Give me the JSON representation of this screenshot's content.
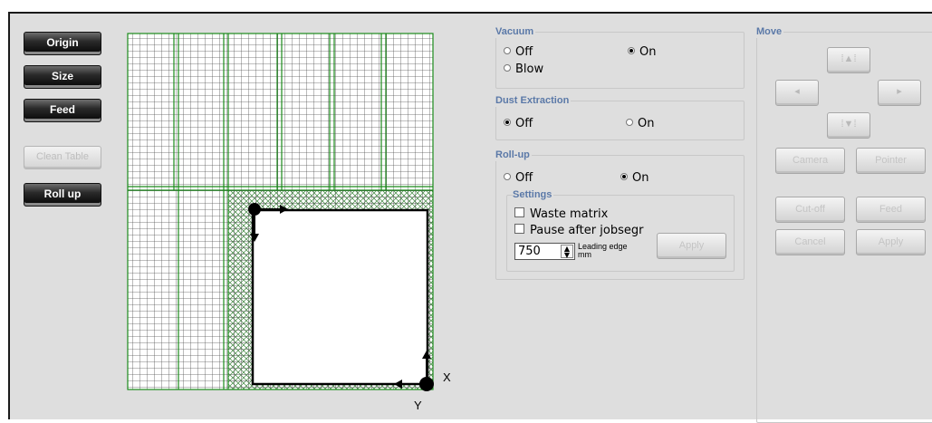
{
  "left_buttons": {
    "origin": "Origin",
    "size": "Size",
    "feed": "Feed",
    "clean_table": "Clean Table",
    "roll_up": "Roll up"
  },
  "canvas": {
    "x_label": "X",
    "y_label": "Y"
  },
  "vacuum": {
    "title": "Vacuum",
    "off": "Off",
    "on": "On",
    "blow": "Blow",
    "selected": "On"
  },
  "dust": {
    "title": "Dust Extraction",
    "off": "Off",
    "on": "On",
    "selected": "Off"
  },
  "rollup": {
    "title": "Roll-up",
    "off": "Off",
    "on": "On",
    "selected": "On",
    "settings_title": "Settings",
    "waste_matrix": "Waste matrix",
    "pause_after": "Pause after jobsegr",
    "leading_edge_value": "750",
    "leading_edge_label": "Leading edge",
    "leading_edge_unit": "mm",
    "apply": "Apply"
  },
  "move": {
    "title": "Move",
    "up_icon": "arrow-up-icon",
    "down_icon": "arrow-down-icon",
    "left_icon": "arrow-left-icon",
    "right_icon": "arrow-right-icon",
    "camera": "Camera",
    "pointer": "Pointer",
    "cutoff": "Cut-off",
    "feed": "Feed",
    "cancel": "Cancel",
    "apply": "Apply"
  }
}
